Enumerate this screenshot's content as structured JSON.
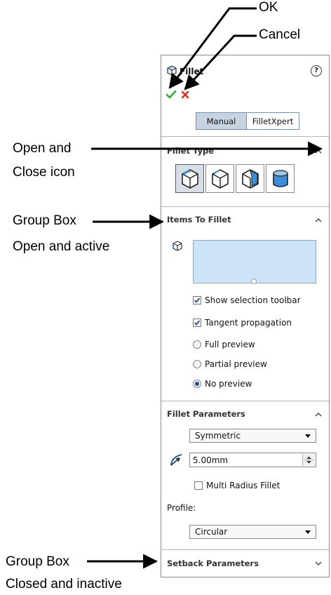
{
  "callouts": {
    "ok": "OK",
    "cancel": "Cancel",
    "open_close_line1": "Open and",
    "open_close_line2": "Close icon",
    "group_open_line1": "Group Box",
    "group_open_line2": "Open and active",
    "group_closed_line1": "Group Box",
    "group_closed_line2": "Closed and inactive"
  },
  "panel": {
    "title": "Fillet",
    "help_glyph": "?",
    "ok_icon": "checkmark-icon",
    "cancel_icon": "x-icon",
    "tabs": [
      {
        "label": "Manual",
        "selected": true
      },
      {
        "label": "FilletXpert",
        "selected": false
      }
    ],
    "sections": {
      "fillet_type": {
        "title": "Fillet Type",
        "expanded": true,
        "icons": [
          "constant-size-fillet-icon",
          "variable-size-fillet-icon",
          "face-fillet-icon",
          "full-round-fillet-icon"
        ],
        "selected_index": 0
      },
      "items": {
        "title": "Items To Fillet",
        "expanded": true,
        "options": [
          {
            "label": "Show selection toolbar",
            "kind": "checkbox",
            "checked": true
          },
          {
            "label": "Tangent propagation",
            "kind": "checkbox",
            "checked": true
          },
          {
            "label": "Full preview",
            "kind": "radio",
            "checked": false
          },
          {
            "label": "Partial preview",
            "kind": "radio",
            "checked": false
          },
          {
            "label": "No preview",
            "kind": "radio",
            "checked": true
          }
        ]
      },
      "params": {
        "title": "Fillet Parameters",
        "expanded": true,
        "method": "Symmetric",
        "radius": "5.00mm",
        "multi_radius": {
          "label": "Multi Radius Fillet",
          "checked": false
        },
        "profile_label": "Profile:",
        "profile": "Circular"
      },
      "setback": {
        "title": "Setback Parameters",
        "expanded": false
      }
    }
  },
  "colors": {
    "ok_green": "#3aa935",
    "cancel_red": "#e0281f",
    "selection_box": "#cde3f8",
    "segment_selected": "#c7d3e1",
    "icon_blue": "#3c8fd6"
  }
}
